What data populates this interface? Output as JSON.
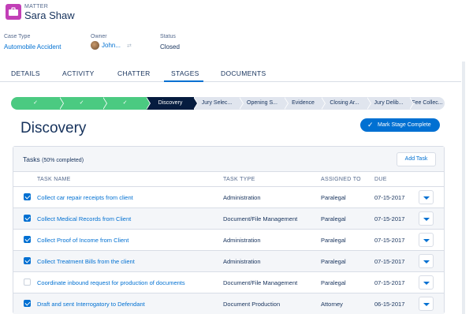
{
  "header": {
    "object_label": "MATTER",
    "record_name": "Sara Shaw"
  },
  "highlights": {
    "case_type": {
      "label": "Case Type",
      "value": "Automobile Accident"
    },
    "owner": {
      "label": "Owner",
      "value": "John..."
    },
    "status": {
      "label": "Status",
      "value": "Closed"
    }
  },
  "tabs": [
    {
      "label": "DETAILS"
    },
    {
      "label": "ACTIVITY"
    },
    {
      "label": "CHATTER"
    },
    {
      "label": "STAGES",
      "active": true
    },
    {
      "label": "DOCUMENTS"
    }
  ],
  "path": {
    "stages": [
      {
        "label": "✓",
        "state": "done"
      },
      {
        "label": "✓",
        "state": "done"
      },
      {
        "label": "✓",
        "state": "done"
      },
      {
        "label": "Discovery",
        "state": "current"
      },
      {
        "label": "Jury Selec...",
        "state": "todo"
      },
      {
        "label": "Opening S...",
        "state": "todo"
      },
      {
        "label": "Evidence",
        "state": "todo"
      },
      {
        "label": "Closing Ar...",
        "state": "todo"
      },
      {
        "label": "Jury Delib...",
        "state": "todo"
      },
      {
        "label": "Fee Collec...",
        "state": "todo"
      }
    ]
  },
  "stage_title": "Discovery",
  "mark_complete_label": "Mark Stage Complete",
  "tasks": {
    "title": "Tasks",
    "subtitle": "(50% completed)",
    "add_label": "Add Task",
    "columns": [
      "TASK NAME",
      "TASK TYPE",
      "ASSIGNED TO",
      "DUE"
    ],
    "rows": [
      {
        "checked": true,
        "name": "Collect car repair receipts from client",
        "type": "Administration",
        "assigned": "Paralegal",
        "due": "07-15-2017"
      },
      {
        "checked": true,
        "name": "Collect Medical Records from Client",
        "type": "Document/File Management",
        "assigned": "Paralegal",
        "due": "07-15-2017"
      },
      {
        "checked": true,
        "name": "Collect Proof of Income from Client",
        "type": "Administration",
        "assigned": "Paralegal",
        "due": "07-15-2017"
      },
      {
        "checked": true,
        "name": "Collect Treatment Bills from the client",
        "type": "Administration",
        "assigned": "Paralegal",
        "due": "07-15-2017"
      },
      {
        "checked": false,
        "name": "Coordinate inbound request for production of documents",
        "type": "Document/File Management",
        "assigned": "Paralegal",
        "due": "07-15-2017"
      },
      {
        "checked": true,
        "name": "Draft and sent Interrogatory to Defendant",
        "type": "Document Production",
        "assigned": "Attorney",
        "due": "06-15-2017"
      }
    ]
  },
  "colors": {
    "brand": "#0070d2",
    "path_done": "#4bca81",
    "path_current": "#061c3f",
    "app_icon": "#c23fb7"
  }
}
